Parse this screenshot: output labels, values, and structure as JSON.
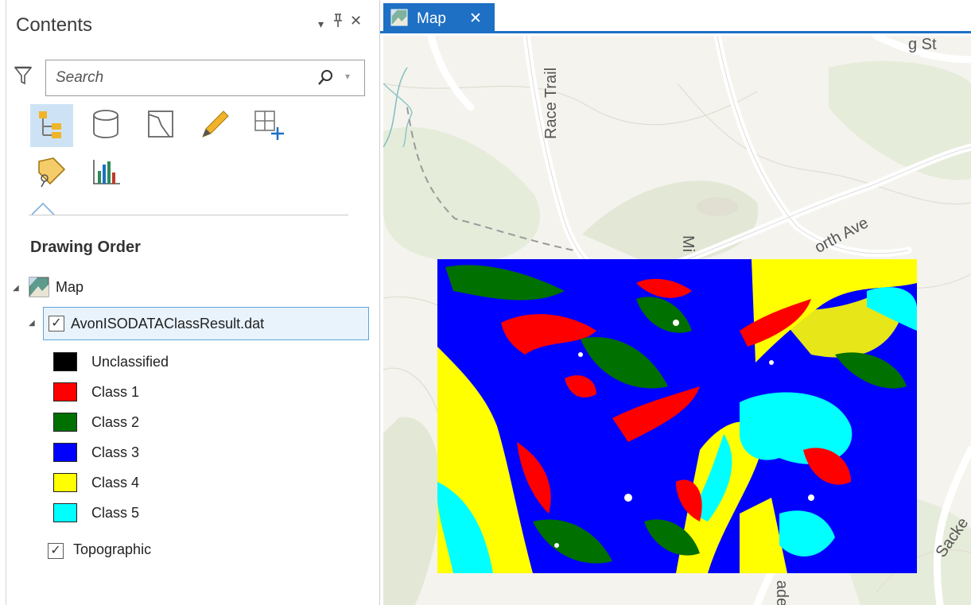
{
  "contents_pane": {
    "title": "Contents",
    "controls": {
      "dropdown": "▾",
      "pin": "ᚚ",
      "close": "✕"
    },
    "search": {
      "placeholder": "Search"
    },
    "view_buttons": [
      {
        "icon": "drawing-order-icon",
        "active": true
      },
      {
        "icon": "data-source-icon",
        "active": false
      },
      {
        "icon": "selection-icon",
        "active": false
      },
      {
        "icon": "editing-icon",
        "active": false
      },
      {
        "icon": "snapping-icon",
        "active": false
      },
      {
        "icon": "labeling-icon",
        "active": false
      },
      {
        "icon": "charts-icon",
        "active": false
      }
    ],
    "section_heading": "Drawing Order",
    "tree": {
      "map_label": "Map",
      "layer": {
        "name": "AvonISODATAClassResult.dat",
        "checked": true
      },
      "legend": [
        {
          "label": "Unclassified",
          "color": "#000000"
        },
        {
          "label": "Class 1",
          "color": "#ff0000"
        },
        {
          "label": "Class 2",
          "color": "#007000"
        },
        {
          "label": "Class 3",
          "color": "#0000ff"
        },
        {
          "label": "Class 4",
          "color": "#ffff00"
        },
        {
          "label": "Class 5",
          "color": "#00ffff"
        }
      ],
      "basemap_layer": {
        "name": "Topographic",
        "checked": true
      }
    }
  },
  "map_view": {
    "tab_label": "Map",
    "tab_close": "✕",
    "map_labels": {
      "race_trail": "Race Trail",
      "north_ave": "orth Ave",
      "top_right": "g St",
      "sackett": "Sacke",
      "vertical_m": "Mi",
      "bottom_ade": "ade"
    }
  },
  "colors": {
    "accent": "#1d70c4",
    "selected_row_bg": "#e9f3fc",
    "selected_row_border": "#5ea4d8",
    "active_tool_bg": "#cde3f5"
  }
}
